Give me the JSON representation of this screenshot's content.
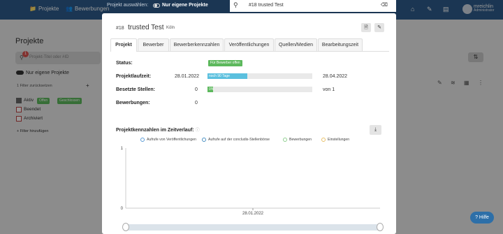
{
  "navbar": {
    "items": [
      {
        "label": "Projekte",
        "icon": "folder-icon"
      },
      {
        "label": "Bewerbungen",
        "icon": "users-icon"
      }
    ],
    "user": {
      "name": "mreichlin",
      "role": "Administrator"
    }
  },
  "background": {
    "title": "Projekte",
    "search_placeholder": "Projekt-Titel oder #ID",
    "search_badge": "1",
    "toggle_label": "Nur eigene Projekte",
    "filter_reset": "1 Filter zurücksetzen",
    "statuses": [
      {
        "label": "Aktiv",
        "checked": true
      },
      {
        "label": "Beendet",
        "checked": false
      },
      {
        "label": "Archiviert",
        "checked": false
      }
    ],
    "status_tags": [
      "Offen",
      "Geschlossen"
    ],
    "add_filter": "Filter hinzufügen"
  },
  "topbar": {
    "project_select_label": "Projekt auswählen:",
    "toggle_label": "Nur eigene Projekte",
    "search_value": "#18 trusted Test"
  },
  "modal": {
    "id": "#18",
    "title": "trusted Test",
    "city": "Köln",
    "tabs": [
      "Projekt",
      "Bewerber",
      "Bewerberkennzahlen",
      "Veröffentlichungen",
      "Quellen/Medien",
      "Bearbeitungszeit"
    ],
    "active_tab": 0,
    "fields": {
      "status_label": "Status:",
      "status_value": "Für Bewerber offen",
      "runtime_label": "Projektlaufzeit:",
      "runtime_start": "28.01.2022",
      "runtime_end": "28.04.2022",
      "runtime_bar_text": "noch 90 Tage",
      "runtime_progress": 0.38,
      "positions_label": "Besetzte Stellen:",
      "positions_filled": "0",
      "positions_total": "von 1",
      "positions_bar_text": "0%",
      "positions_progress": 0.05,
      "applications_label": "Bewerbungen:",
      "applications_value": "0"
    },
    "chart_title": "Projektkennzahlen im Zeitverlauf:"
  },
  "colors": {
    "navbar": "#2d5b8a",
    "progress_runtime": "#5bc0de",
    "progress_positions": "#5cb85c",
    "badge_green": "#5cb85c"
  },
  "chart_data": {
    "type": "line",
    "x": [
      "28.01.2022"
    ],
    "series": [
      {
        "name": "Aufrufe von Veröffentlichungen",
        "values": [
          0
        ],
        "color": "#5b9bd5"
      },
      {
        "name": "Aufrufe auf der concludis-Stellenbörse",
        "values": [
          0
        ],
        "color": "#4a90c2"
      },
      {
        "name": "Bewerbungen",
        "values": [
          0
        ],
        "color": "#8fcf8f"
      },
      {
        "name": "Einstellungen",
        "values": [
          0
        ],
        "color": "#e8c16a"
      }
    ],
    "ylim": [
      0,
      1
    ],
    "yticks": [
      "0",
      "1"
    ],
    "xticks": [
      "28.01.2022"
    ],
    "legend": "top"
  },
  "help": {
    "label": "Hilfe"
  }
}
